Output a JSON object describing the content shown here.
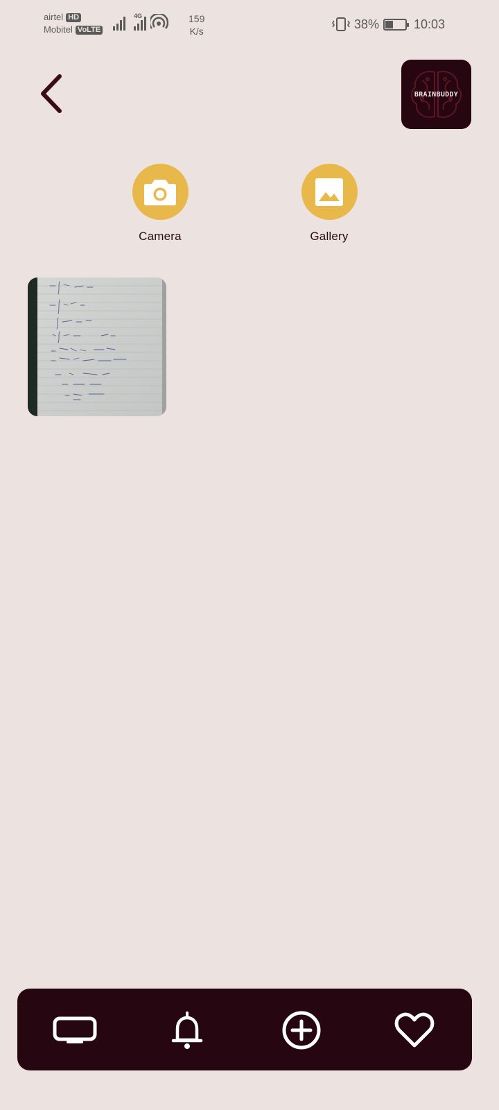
{
  "status_bar": {
    "carrier1": "airtel",
    "carrier1_badge": "HD",
    "carrier2": "Mobitel",
    "carrier2_badge": "VoLTE",
    "network_type": "4G",
    "speed_value": "159",
    "speed_unit": "K/s",
    "battery_percent": "38%",
    "battery_level": 0.38,
    "time": "10:03"
  },
  "header": {
    "back_icon": "chevron-left-icon",
    "logo_text": "BRAINBUDDY"
  },
  "actions": [
    {
      "label": "Camera",
      "icon": "camera-icon"
    },
    {
      "label": "Gallery",
      "icon": "image-icon"
    }
  ],
  "photos": [
    {
      "alt": "handwritten-math-notes-photo"
    }
  ],
  "bottom_nav": [
    {
      "icon": "tv-icon"
    },
    {
      "icon": "bell-icon"
    },
    {
      "icon": "plus-circle-icon"
    },
    {
      "icon": "heart-icon"
    }
  ],
  "colors": {
    "background": "#ece3e1",
    "accent": "#e8b84a",
    "dark": "#260711",
    "text": "#2a0a12"
  }
}
